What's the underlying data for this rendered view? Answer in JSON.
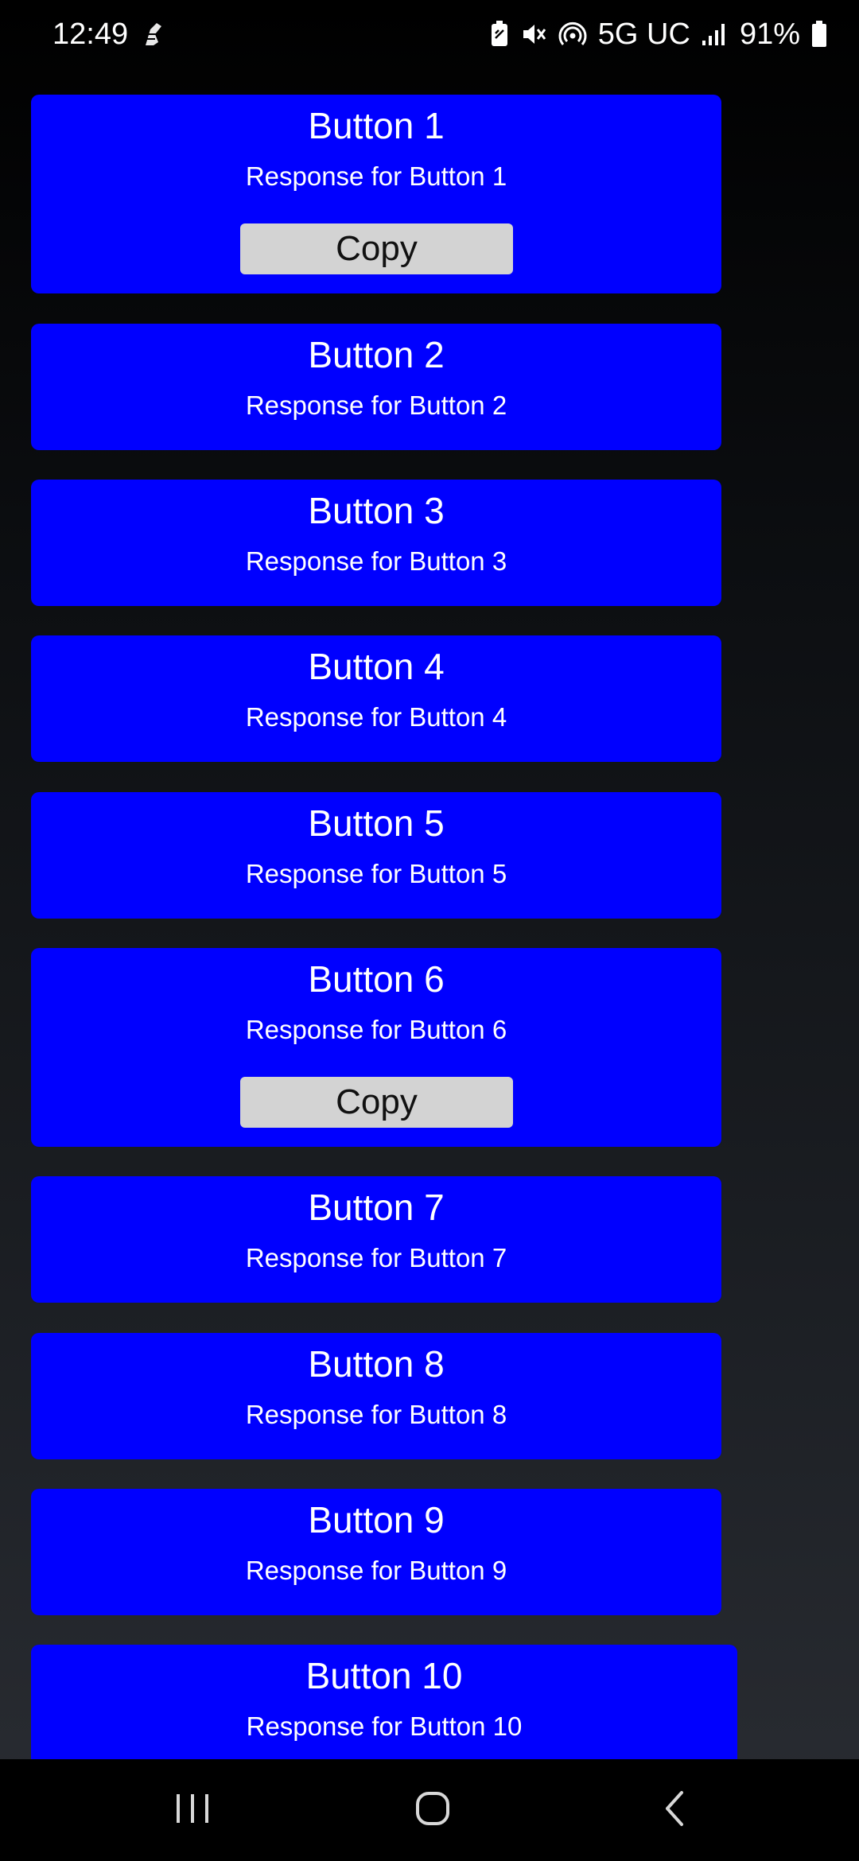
{
  "status_bar": {
    "time": "12:49",
    "network": "5G UC",
    "battery": "91%"
  },
  "cards": [
    {
      "title": "Button 1",
      "response": "Response for Button 1",
      "copy_label": "Copy"
    },
    {
      "title": "Button 2",
      "response": "Response for Button 2"
    },
    {
      "title": "Button 3",
      "response": "Response for Button 3"
    },
    {
      "title": "Button 4",
      "response": "Response for Button 4"
    },
    {
      "title": "Button 5",
      "response": "Response for Button 5"
    },
    {
      "title": "Button 6",
      "response": "Response for Button 6",
      "copy_label": "Copy"
    },
    {
      "title": "Button 7",
      "response": "Response for Button 7"
    },
    {
      "title": "Button 8",
      "response": "Response for Button 8"
    },
    {
      "title": "Button 9",
      "response": "Response for Button 9"
    },
    {
      "title": "Button 10",
      "response": "Response for Button 10"
    }
  ],
  "nav": {
    "recents": "recents-icon",
    "home": "home-icon",
    "back": "back-icon"
  },
  "colors": {
    "card_background": "#0000ff",
    "copy_button": "#d3d3d3"
  }
}
